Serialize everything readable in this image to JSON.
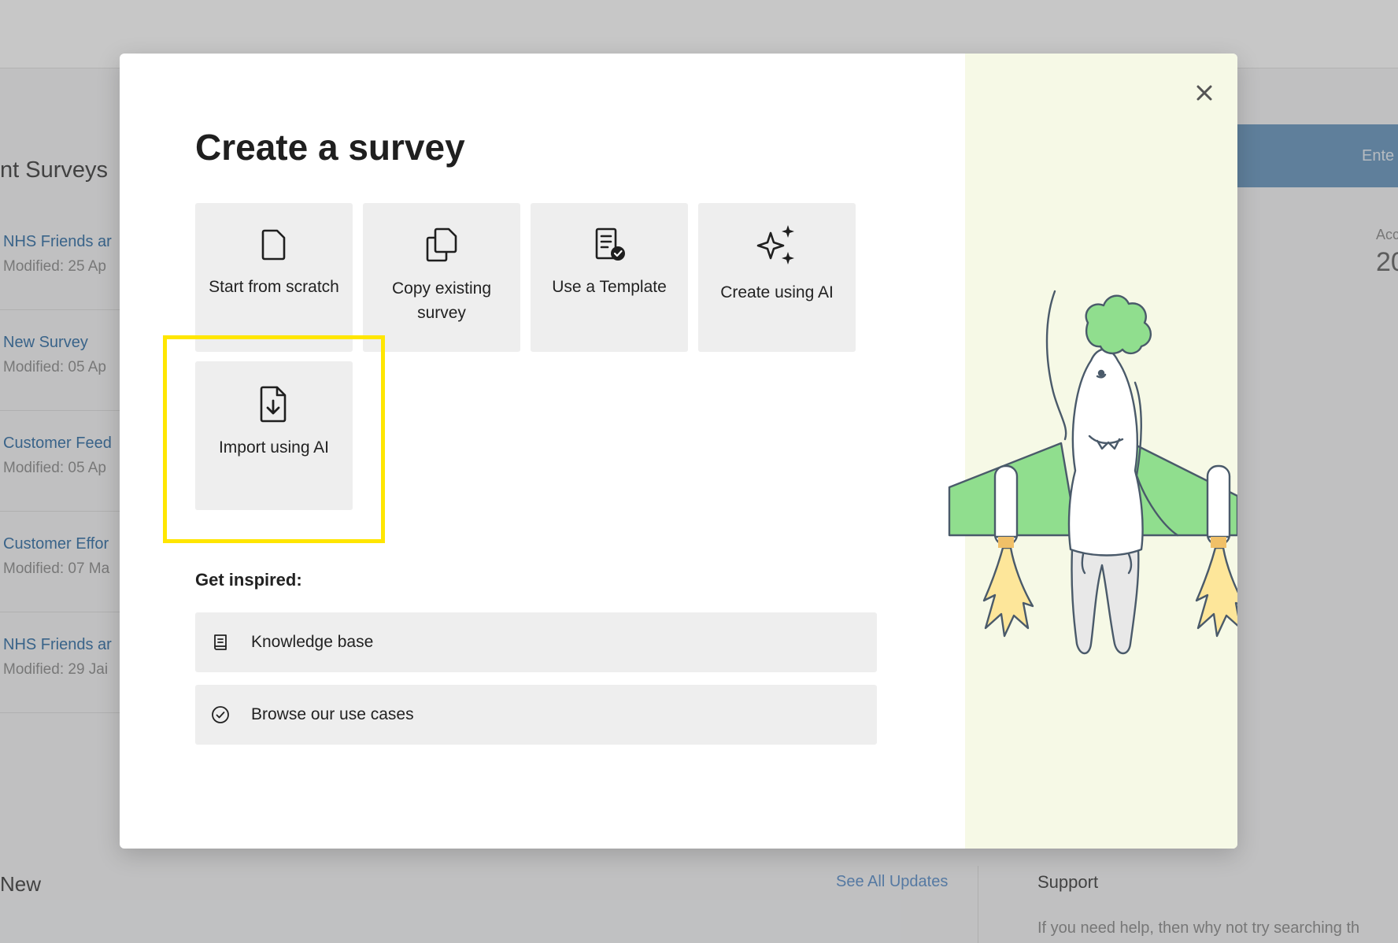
{
  "background": {
    "section_heading": "nt Surveys",
    "surveys": [
      {
        "title": "NHS Friends ar",
        "meta": "Modified: 25 Ap"
      },
      {
        "title": "New Survey",
        "meta": "Modified: 05 Ap"
      },
      {
        "title": "Customer Feed",
        "meta": "Modified: 05 Ap"
      },
      {
        "title": "Customer Effor",
        "meta": "Modified: 07 Ma"
      },
      {
        "title": "NHS Friends ar",
        "meta": "Modified: 29 Jai"
      }
    ],
    "banner_text": "Ente",
    "stat_label": "Acc",
    "stat_value": "20",
    "whats_new": "New",
    "see_all": "See All Updates",
    "support_title": "Support",
    "support_text": "If you need help, then why not try searching th"
  },
  "modal": {
    "title": "Create a survey",
    "close_icon": "close-icon",
    "options": [
      {
        "label": "Start from scratch",
        "icon": "blank-document-icon"
      },
      {
        "label": "Copy existing survey",
        "icon": "copy-icon"
      },
      {
        "label": "Use a Template",
        "icon": "template-document-icon"
      },
      {
        "label": "Create using AI",
        "icon": "sparkles-icon"
      },
      {
        "label": "Import using AI",
        "icon": "document-import-icon"
      }
    ],
    "highlighted_option": "Import using AI",
    "highlight_color": "#FFE600",
    "inspired_label": "Get inspired:",
    "links": [
      {
        "label": "Knowledge base",
        "icon": "book-icon"
      },
      {
        "label": "Browse our use cases",
        "icon": "check-circle-icon"
      }
    ],
    "illustration_bg": "#F6F9E6",
    "accent_green": "#90DE8E",
    "flame_yellow": "#FDE69A"
  }
}
